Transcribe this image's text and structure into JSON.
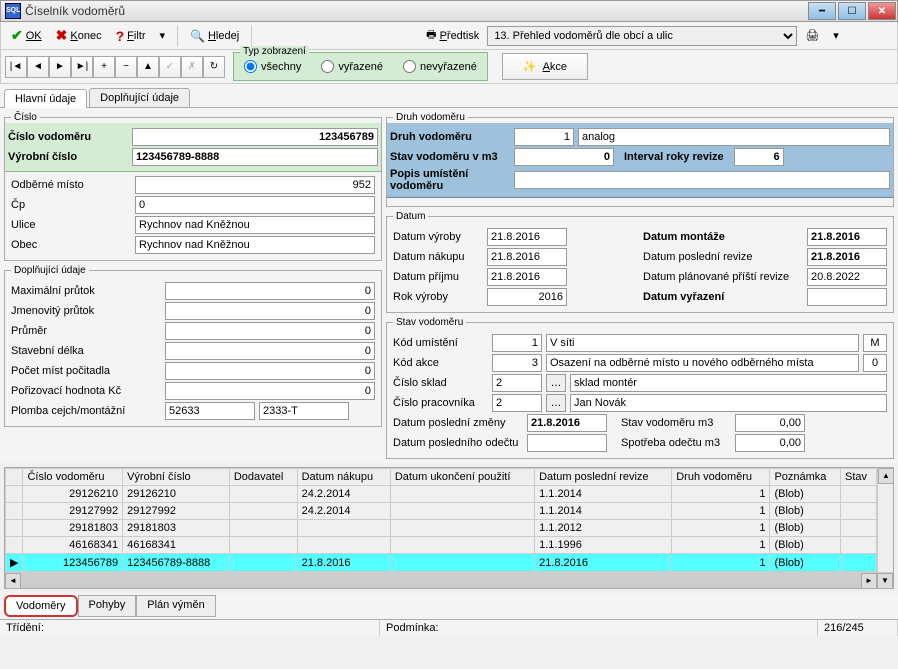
{
  "window": {
    "title": "Číselník vodoměrů"
  },
  "toolbar": {
    "ok": "OK",
    "konec": "Konec",
    "filtr": "Filtr",
    "hledej": "Hledej",
    "predtisk": "Předtisk",
    "predtisk_select": "13. Přehled vodoměrů dle obcí a ulic"
  },
  "display_type": {
    "legend": "Typ zobrazení",
    "opt1": "všechny",
    "opt2": "vyřazené",
    "opt3": "nevyřazené"
  },
  "akce": "Akce",
  "tabs": {
    "t1": "Hlavní údaje",
    "t2": "Doplňující údaje"
  },
  "cislo": {
    "legend": "Číslo",
    "cislo_vodomeru_lbl": "Číslo vodoměru",
    "cislo_vodomeru_val": "123456789",
    "vyrobni_lbl": "Výrobní číslo",
    "vyrobni_val": "123456789-8888",
    "odberne_lbl": "Odběrné místo",
    "odberne_val": "952",
    "cp_lbl": "Čp",
    "cp_val": "0",
    "ulice_lbl": "Ulice",
    "ulice_val": "Rychnov nad Kněžnou",
    "obec_lbl": "Obec",
    "obec_val": "Rychnov nad Kněžnou"
  },
  "dopln": {
    "legend": "Doplňující údaje",
    "max_lbl": "Maximální průtok",
    "max_val": "0",
    "jmen_lbl": "Jmenovitý průtok",
    "jmen_val": "0",
    "prumer_lbl": "Průměr",
    "prumer_val": "0",
    "staveb_lbl": "Stavební délka",
    "staveb_val": "0",
    "pocet_lbl": "Počet míst počitadla",
    "pocet_val": "0",
    "poriz_lbl": "Pořizovací hodnota Kč",
    "poriz_val": "0",
    "plomba_lbl": "Plomba cejch/montážní",
    "plomba_v1": "52633",
    "plomba_v2": "2333-T"
  },
  "druh": {
    "legend": "Druh vodoměru",
    "druh_lbl": "Druh vodoměru",
    "druh_val": "1",
    "druh_text": "analog",
    "stav_lbl": "Stav vodoměru v m3",
    "stav_val": "0",
    "interval_lbl": "Interval roky revize",
    "interval_val": "6",
    "popis_lbl": "Popis umístění vodoměru",
    "popis_val": ""
  },
  "datum": {
    "legend": "Datum",
    "vyroby_lbl": "Datum výroby",
    "vyroby_val": "21.8.2016",
    "nakupu_lbl": "Datum nákupu",
    "nakupu_val": "21.8.2016",
    "prijmu_lbl": "Datum příjmu",
    "prijmu_val": "21.8.2016",
    "rok_lbl": "Rok výroby",
    "rok_val": "2016",
    "montaze_lbl": "Datum montáže",
    "montaze_val": "21.8.2016",
    "posled_rev_lbl": "Datum poslední revize",
    "posled_rev_val": "21.8.2016",
    "plan_rev_lbl": "Datum plánované příští revize",
    "plan_rev_val": "20.8.2022",
    "vyraz_lbl": "Datum vyřazení",
    "vyraz_val": ""
  },
  "stav": {
    "legend": "Stav vodoměru",
    "kod_um_lbl": "Kód umístění",
    "kod_um_val": "1",
    "kod_um_text": "V síti",
    "kod_um_m": "M",
    "kod_akce_lbl": "Kód akce",
    "kod_akce_val": "3",
    "kod_akce_text": "Osazení na odběrné místo u nového odběrného místa",
    "kod_akce_0": "0",
    "sklad_lbl": "Číslo sklad",
    "sklad_val": "2",
    "sklad_text": "sklad montér",
    "prac_lbl": "Číslo pracovníka",
    "prac_val": "2",
    "prac_text": "Jan Novák",
    "posled_zm_lbl": "Datum poslední změny",
    "posled_zm_val": "21.8.2016",
    "posled_od_lbl": "Datum posledního odečtu",
    "posled_od_val": "",
    "stav_m3_lbl": "Stav vodoměru m3",
    "stav_m3_val": "0,00",
    "spotr_lbl": "Spotřeba odečtu m3",
    "spotr_val": "0,00"
  },
  "grid": {
    "headers": [
      "Číslo vodoměru",
      "Výrobní číslo",
      "Dodavatel",
      "Datum nákupu",
      "Datum ukončení použití",
      "Datum poslední revize",
      "Druh vodoměru",
      "Poznámka",
      "Stav"
    ],
    "rows": [
      {
        "c": "29126210",
        "v": "29126210",
        "d": "",
        "dn": "24.2.2014",
        "du": "",
        "dr": "1.1.2014",
        "dv": "1",
        "p": "(Blob)",
        "s": ""
      },
      {
        "c": "29127992",
        "v": "29127992",
        "d": "",
        "dn": "24.2.2014",
        "du": "",
        "dr": "1.1.2014",
        "dv": "1",
        "p": "(Blob)",
        "s": ""
      },
      {
        "c": "29181803",
        "v": "29181803",
        "d": "",
        "dn": "",
        "du": "",
        "dr": "1.1.2012",
        "dv": "1",
        "p": "(Blob)",
        "s": ""
      },
      {
        "c": "46168341",
        "v": "46168341",
        "d": "",
        "dn": "",
        "du": "",
        "dr": "1.1.1996",
        "dv": "1",
        "p": "(Blob)",
        "s": ""
      },
      {
        "c": "123456789",
        "v": "123456789-8888",
        "d": "",
        "dn": "21.8.2016",
        "du": "",
        "dr": "21.8.2016",
        "dv": "1",
        "p": "(Blob)",
        "s": "",
        "sel": true
      }
    ]
  },
  "bottom_tabs": {
    "t1": "Vodoměry",
    "t2": "Pohyby",
    "t3": "Plán výměn"
  },
  "statusbar": {
    "trideni": "Třídění:",
    "podminka": "Podmínka:",
    "counter": "216/245"
  }
}
